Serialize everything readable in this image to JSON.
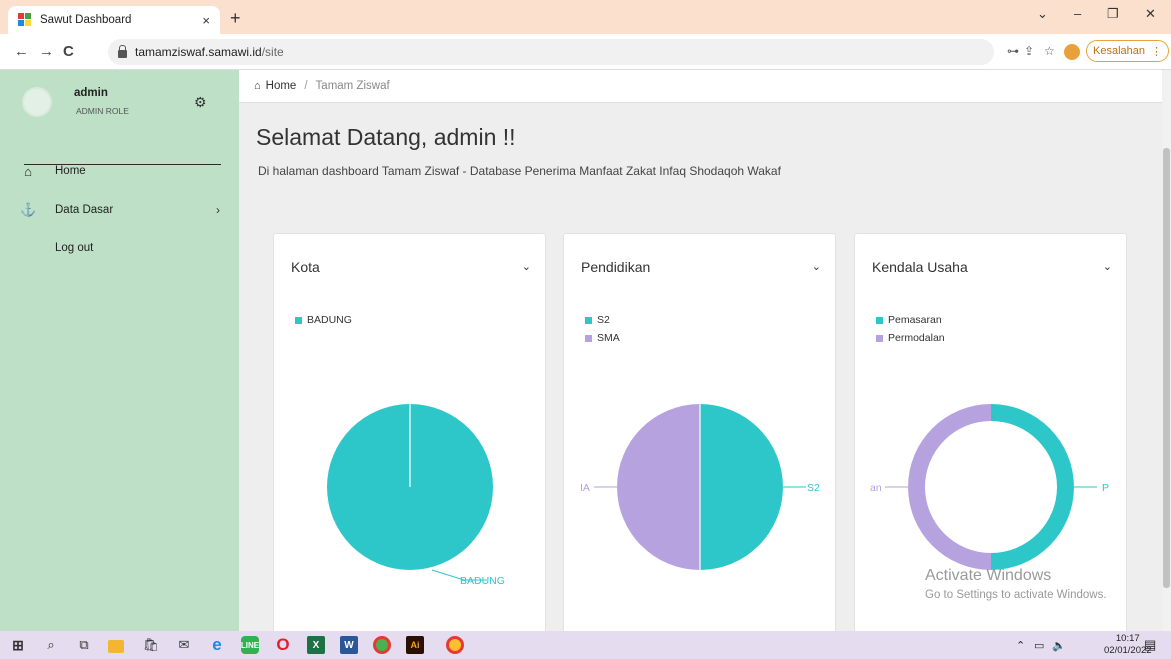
{
  "browser": {
    "tab_title": "Sawut Dashboard",
    "tab_close": "×",
    "new_tab": "+",
    "url_host": "tamamziswaf.samawi.id",
    "url_path": "/site",
    "profile_button": "Kesalahan",
    "profile_menu": "⋮",
    "window_controls": [
      "⌄",
      "–",
      "❐",
      "✕"
    ]
  },
  "sidebar": {
    "user_name": "admin",
    "user_role": "ADMIN ROLE",
    "items": [
      {
        "label": "Home",
        "icon": "home-icon"
      },
      {
        "label": "Data Dasar",
        "icon": "anchor-icon"
      },
      {
        "label": "Log out",
        "icon": ""
      }
    ]
  },
  "breadcrumb": {
    "home": "Home",
    "separator": "/",
    "current": "Tamam Ziswaf"
  },
  "page": {
    "welcome": "Selamat Datang, admin !!",
    "subtitle": "Di halaman dashboard Tamam Ziswaf - Database Penerima Manfaat Zakat Infaq Shodaqoh Wakaf"
  },
  "colors": {
    "teal": "#2ec7c9",
    "purple": "#b6a2de"
  },
  "chart_data": [
    {
      "type": "pie",
      "title": "Kota",
      "categories": [
        "BADUNG"
      ],
      "values": [
        1
      ],
      "slice_labels": [
        "BADUNG"
      ]
    },
    {
      "type": "pie",
      "title": "Pendidikan",
      "categories": [
        "S2",
        "SMA"
      ],
      "values": [
        1,
        1
      ],
      "slice_labels": [
        "S2",
        "IA"
      ]
    },
    {
      "type": "pie",
      "title": "Kendala Usaha",
      "categories": [
        "Pemasaran",
        "Permodalan"
      ],
      "values": [
        1,
        1
      ],
      "donut": true,
      "slice_labels": [
        "P",
        "an"
      ]
    }
  ],
  "watermark": {
    "line1": "Activate Windows",
    "line2": "Go to Settings to activate Windows."
  },
  "taskbar": {
    "time": "10:17",
    "date": "02/01/2022"
  }
}
